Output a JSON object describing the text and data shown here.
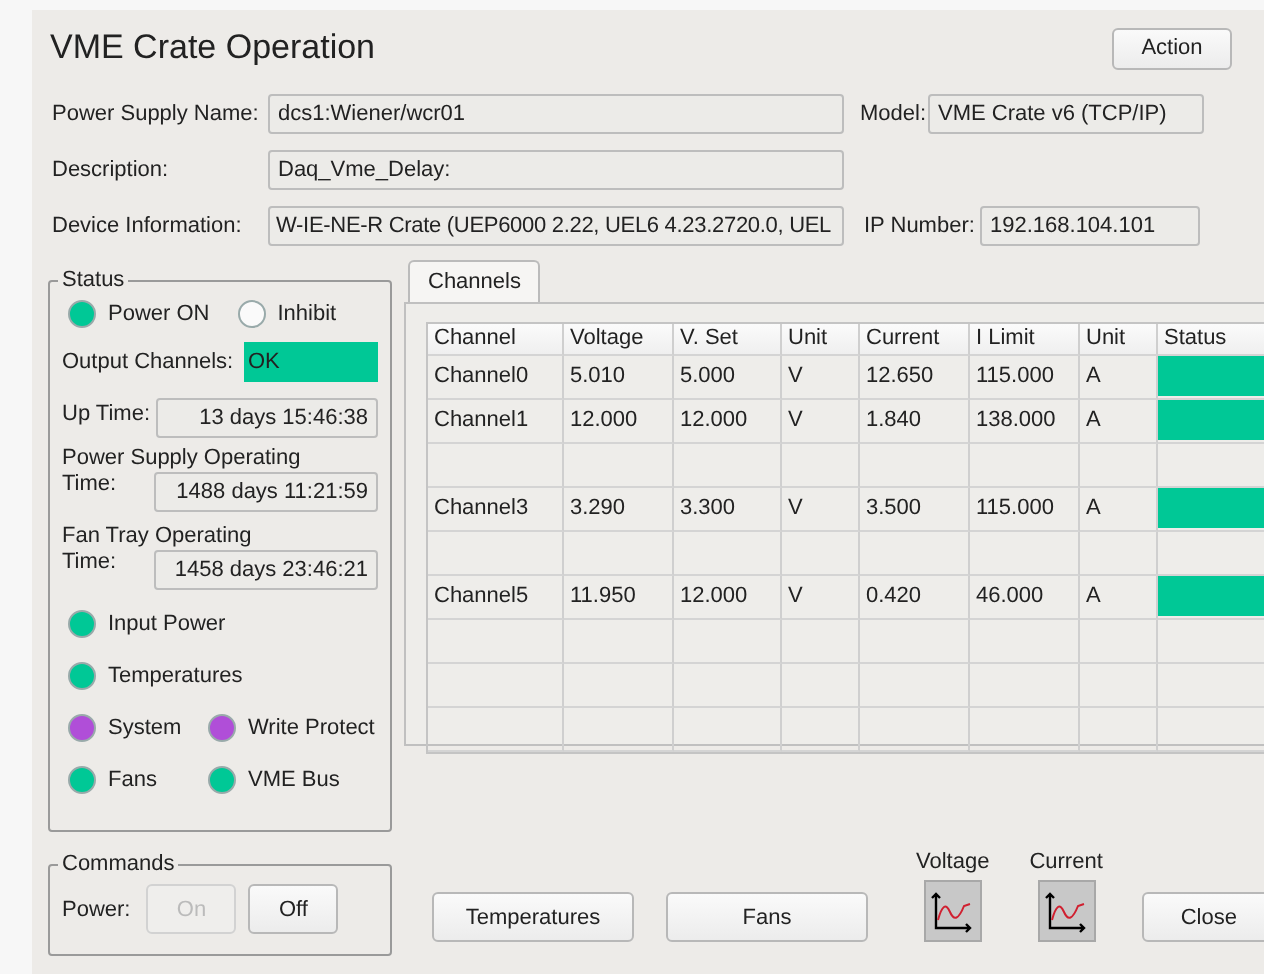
{
  "title": "VME Crate Operation",
  "action_button": "Action",
  "power_supply_name": {
    "label": "Power Supply Name:",
    "value": "dcs1:Wiener/wcr01"
  },
  "model": {
    "label": "Model:",
    "value": "VME Crate v6 (TCP/IP)"
  },
  "description": {
    "label": "Description:",
    "value": "Daq_Vme_Delay:"
  },
  "device_information": {
    "label": "Device Information:",
    "value": "W-IE-NE-R Crate (UEP6000 2.22, UEL6 4.23.2720.0, UEL"
  },
  "ip_number": {
    "label": "IP Number:",
    "value": "192.168.104.101"
  },
  "status": {
    "legend": "Status",
    "top_leds": [
      {
        "label": "Power ON",
        "on": true,
        "color": "#00c896"
      },
      {
        "label": "Inhibit",
        "on": false
      }
    ],
    "output_channels": {
      "label": "Output Channels:",
      "value": "OK",
      "color": "#00c896"
    },
    "up_time": {
      "label": "Up Time:",
      "value": "13 days 15:46:38"
    },
    "operating_times": [
      {
        "label": "Power Supply Operating",
        "label_2": "Time:",
        "value": "1488 days 11:21:59"
      },
      {
        "label": "Fan Tray Operating",
        "label_2": "Time:",
        "value": "1458 days 23:46:21"
      }
    ],
    "led_rows": [
      [
        {
          "label": "Input Power",
          "on": true,
          "color": "#00c896"
        }
      ],
      [
        {
          "label": "Temperatures",
          "on": true,
          "color": "#00c896"
        }
      ],
      [
        {
          "label": "System",
          "on": true,
          "color": "#b04ed8"
        },
        {
          "label": "Write Protect",
          "on": true,
          "color": "#b04ed8"
        }
      ],
      [
        {
          "label": "Fans",
          "on": true,
          "color": "#00c896"
        },
        {
          "label": "VME Bus",
          "on": true,
          "color": "#00c896"
        }
      ]
    ]
  },
  "commands": {
    "legend": "Commands",
    "label": "Power:",
    "buttons": [
      {
        "label": "On",
        "disabled": true
      },
      {
        "label": "Off",
        "disabled": false
      }
    ]
  },
  "tabs": [
    {
      "label": "Channels",
      "selected": true
    }
  ],
  "table": {
    "columns": [
      "Channel",
      "Voltage",
      "V. Set",
      "Unit",
      "Current",
      "I Limit",
      "Unit",
      "Status"
    ],
    "rows": [
      {
        "kind": "channel",
        "cells": [
          "Channel0",
          "5.010",
          "5.000",
          "V",
          "12.650",
          "115.000",
          "A"
        ],
        "color": "#00c896"
      },
      {
        "kind": "channel",
        "cells": [
          "Channel1",
          "12.000",
          "12.000",
          "V",
          "1.840",
          "138.000",
          "A"
        ],
        "color": "#00c896"
      },
      {
        "kind": "empty"
      },
      {
        "kind": "channel",
        "cells": [
          "Channel3",
          "3.290",
          "3.300",
          "V",
          "3.500",
          "115.000",
          "A"
        ],
        "color": "#00c896"
      },
      {
        "kind": "empty"
      },
      {
        "kind": "channel",
        "cells": [
          "Channel5",
          "11.950",
          "12.000",
          "V",
          "0.420",
          "46.000",
          "A"
        ],
        "color": "#00c896"
      },
      {
        "kind": "empty"
      },
      {
        "kind": "empty"
      },
      {
        "kind": "empty"
      }
    ]
  },
  "bottom_buttons": [
    "Temperatures",
    "Fans"
  ],
  "plot_buttons": [
    {
      "label": "Voltage"
    },
    {
      "label": "Current"
    }
  ],
  "close_button": "Close"
}
